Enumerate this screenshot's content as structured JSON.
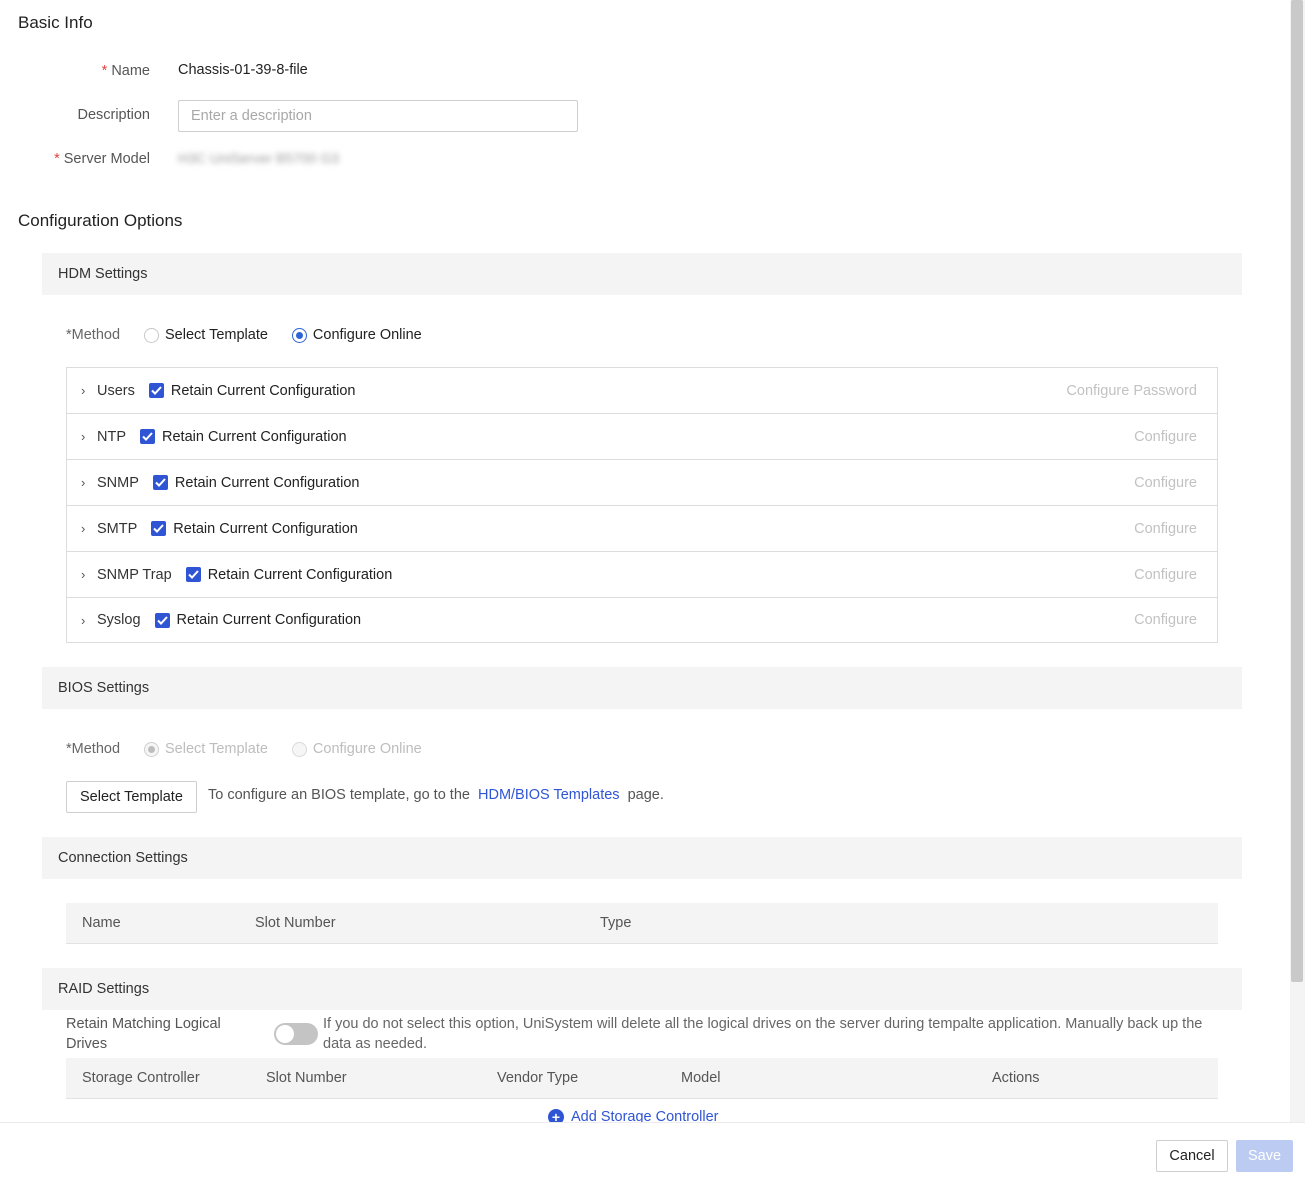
{
  "basic_info": {
    "title": "Basic Info",
    "name_label": "Name",
    "name_value": "Chassis-01-39-8-file",
    "description_label": "Description",
    "description_placeholder": "Enter a description",
    "description_value": "",
    "server_model_label": "Server Model",
    "server_model_value": "H3C UniServer B5700 G3",
    "required_mark": "*"
  },
  "config": {
    "title": "Configuration Options"
  },
  "hdm": {
    "title": "HDM Settings",
    "method_label": "*Method",
    "options": [
      "Select Template",
      "Configure Online"
    ],
    "selected": "Configure Online",
    "rows": [
      {
        "name": "Users",
        "checkbox": "Retain Current Configuration",
        "checked": true,
        "action": "Configure Password"
      },
      {
        "name": "NTP",
        "checkbox": "Retain Current Configuration",
        "checked": true,
        "action": "Configure"
      },
      {
        "name": "SNMP",
        "checkbox": "Retain Current Configuration",
        "checked": true,
        "action": "Configure"
      },
      {
        "name": "SMTP",
        "checkbox": "Retain Current Configuration",
        "checked": true,
        "action": "Configure"
      },
      {
        "name": "SNMP Trap",
        "checkbox": "Retain Current Configuration",
        "checked": true,
        "action": "Configure"
      },
      {
        "name": "Syslog",
        "checkbox": "Retain Current Configuration",
        "checked": true,
        "action": "Configure"
      }
    ]
  },
  "bios": {
    "title": "BIOS Settings",
    "method_label": "*Method",
    "options": [
      "Select Template",
      "Configure Online"
    ],
    "selected": "Select Template",
    "select_button": "Select Template",
    "hint_before": "To configure an BIOS template, go to the",
    "hint_link": "HDM/BIOS Templates",
    "hint_after": "page."
  },
  "connection": {
    "title": "Connection Settings",
    "columns": [
      "Name",
      "Slot Number",
      "Type"
    ]
  },
  "raid": {
    "title": "RAID Settings",
    "retain_label": "Retain Matching Logical Drives",
    "retain_enabled": false,
    "retain_desc": "If you do not select this option, UniSystem will delete all the logical drives on the server during tempalte application. Manually back up the data as needed.",
    "columns": [
      "Storage Controller",
      "Slot Number",
      "Vendor Type",
      "Model",
      "Actions"
    ],
    "add_label": "Add Storage Controller"
  },
  "footer": {
    "cancel": "Cancel",
    "save": "Save"
  },
  "colors": {
    "accent": "#2f55d4",
    "panel_bg": "#f4f4f4",
    "save_disabled": "#bccbf1"
  }
}
